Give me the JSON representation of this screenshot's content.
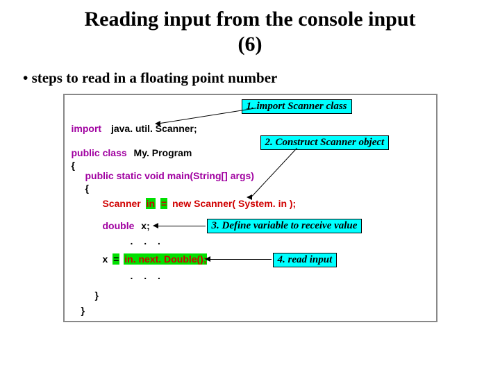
{
  "title_line1": "Reading input from the console input",
  "title_line2": "(6)",
  "bullet": "steps to read in a floating point number",
  "callouts": {
    "c1": "1. import  Scanner class",
    "c2": "2. Construct Scanner object",
    "c3": "3. Define variable to receive value",
    "c4": "4. read input"
  },
  "code": {
    "import_kw": "import",
    "import_pkg": "java. util. Scanner;",
    "public_class": "public class",
    "class_name": "My. Program",
    "open_brace": "{",
    "main_sig": "public static void main(String[] args)",
    "open_brace2": "{",
    "scanner_decl_left": "Scanner",
    "scanner_var": "in",
    "scanner_eq": "=",
    "scanner_decl_right": "new Scanner( System. in   );",
    "double_kw": "double",
    "double_var": "x;",
    "read_x": "x",
    "read_eq": "=",
    "read_call": "in. next. Double();",
    "close_brace2": "}",
    "close_brace": "}",
    "dots": ". . ."
  }
}
